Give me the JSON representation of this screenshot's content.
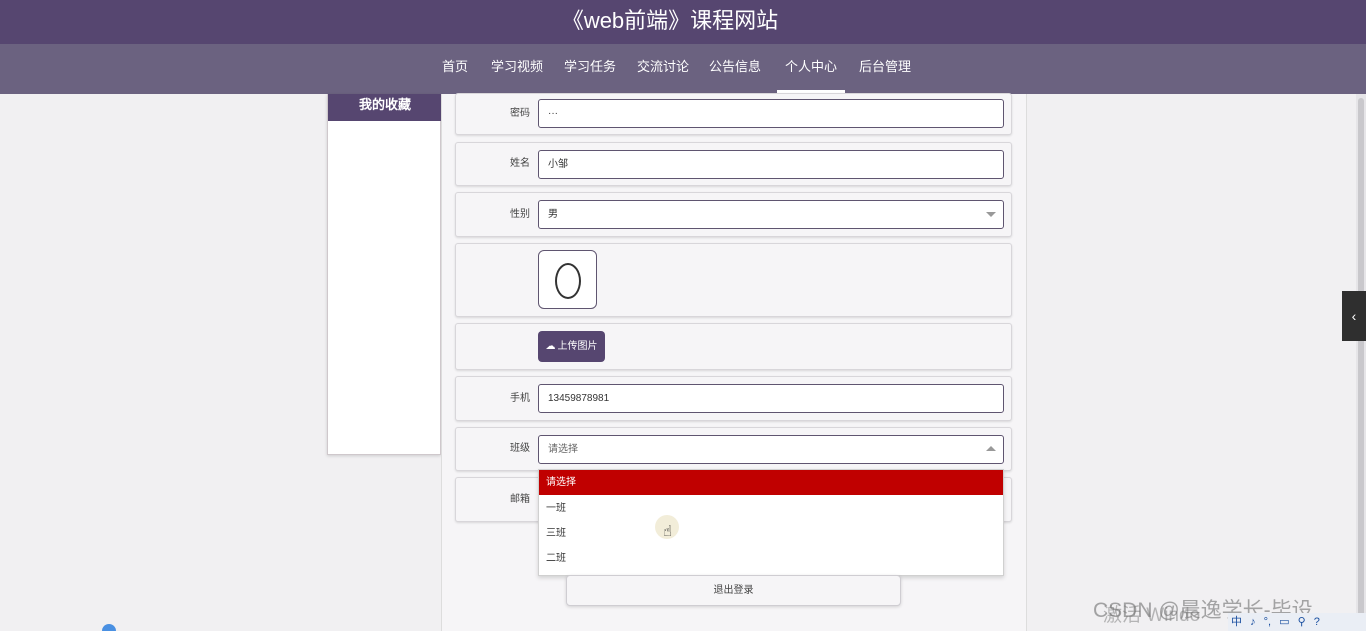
{
  "header": {
    "title": "《web前端》课程网站"
  },
  "nav": {
    "items": [
      "首页",
      "学习视频",
      "学习任务",
      "交流讨论",
      "公告信息",
      "个人中心",
      "后台管理"
    ],
    "active": "个人中心"
  },
  "sidebar": {
    "items": [
      {
        "label": "我的收藏"
      }
    ]
  },
  "form": {
    "password": {
      "label": "密码",
      "value": "···"
    },
    "name": {
      "label": "姓名",
      "value": "小邹"
    },
    "gender": {
      "label": "性别",
      "value": "男"
    },
    "upload_label": "上传图片",
    "phone": {
      "label": "手机",
      "value": "13459878981"
    },
    "class": {
      "label": "班级",
      "value": "请选择",
      "options": [
        "请选择",
        "一班",
        "三班",
        "二班"
      ],
      "selected": "请选择"
    },
    "email": {
      "label": "邮箱"
    },
    "logout_label": "退出登录"
  },
  "icons": {
    "upload": "cloud-upload-icon",
    "side_tab": "chevron-left-icon"
  },
  "colors": {
    "brand": "#564670",
    "nav": "#6b6280",
    "selected_option": "#c00000"
  },
  "overlay": {
    "watermark": "激活 Windo",
    "csdn": "CSDN @晨逸学长-毕设",
    "tray_items": [
      "中",
      "♪",
      "°,",
      "▭",
      "⚲",
      "?"
    ]
  }
}
